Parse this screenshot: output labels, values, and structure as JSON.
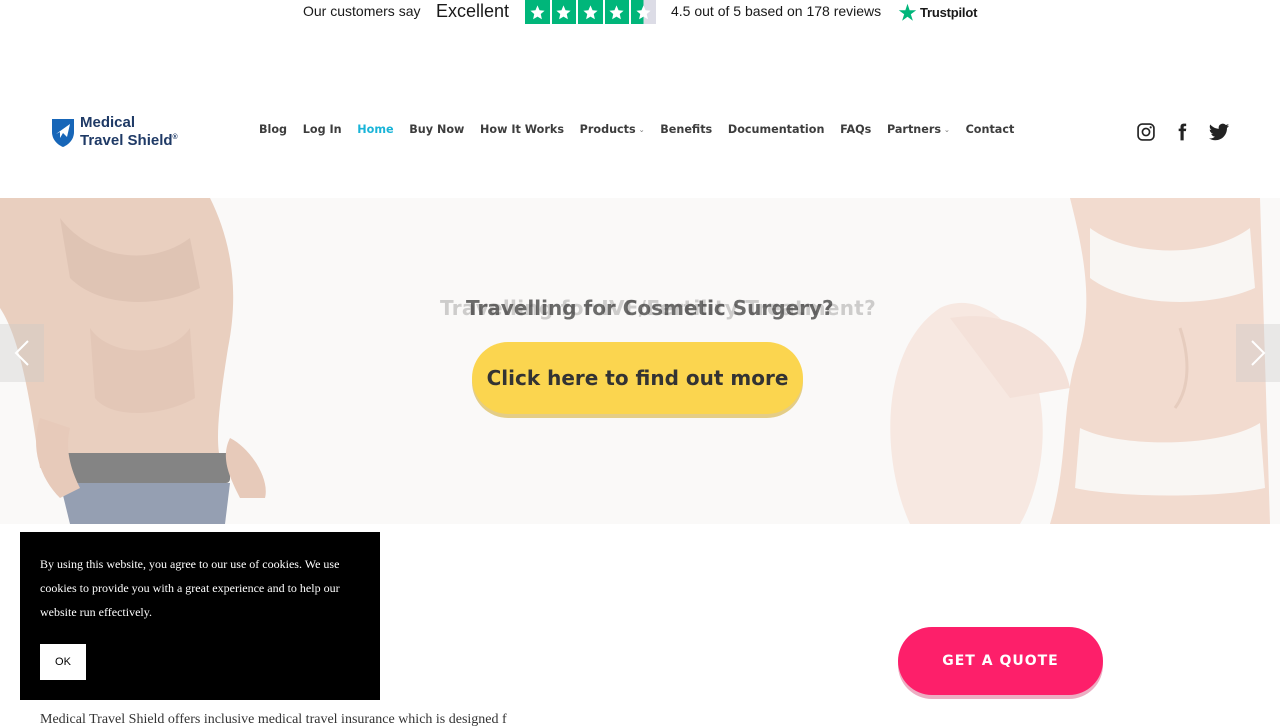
{
  "trustpilot": {
    "say": "Our customers say",
    "rating_word": "Excellent",
    "score_text": "4.5 out of 5 based on 178 reviews",
    "brand": "Trustpilot",
    "stars": 4.5,
    "color": "#00b67a"
  },
  "logo": {
    "line1": "Medical",
    "line2": "Travel Shield"
  },
  "nav": {
    "items": [
      {
        "label": "Blog"
      },
      {
        "label": "Log In"
      },
      {
        "label": "Home",
        "active": true
      },
      {
        "label": "Buy Now"
      },
      {
        "label": "How It Works"
      },
      {
        "label": "Products",
        "dropdown": true
      },
      {
        "label": "Benefits"
      },
      {
        "label": "Documentation"
      },
      {
        "label": "FAQs"
      },
      {
        "label": "Partners",
        "dropdown": true
      },
      {
        "label": "Contact"
      }
    ],
    "active_color": "#19b4d8"
  },
  "social": [
    "instagram-icon",
    "facebook-icon",
    "twitter-icon"
  ],
  "hero": {
    "ghost_title": "Travelling for IVF/Fertility Treatment?",
    "title": "Travelling for Cosmetic Surgery?",
    "cta": "Click here to find out more",
    "cta_color": "#fbd54f"
  },
  "cookie": {
    "text": "By using this website, you agree to our use of cookies. We use cookies to provide you with a great experience and to help our website run effectively.",
    "ok": "OK"
  },
  "quote": {
    "label": "GET A QUOTE",
    "color": "#fd1f6a"
  },
  "bottom": {
    "text": "Medical Travel Shield offers inclusive medical travel insurance which is designed f"
  }
}
